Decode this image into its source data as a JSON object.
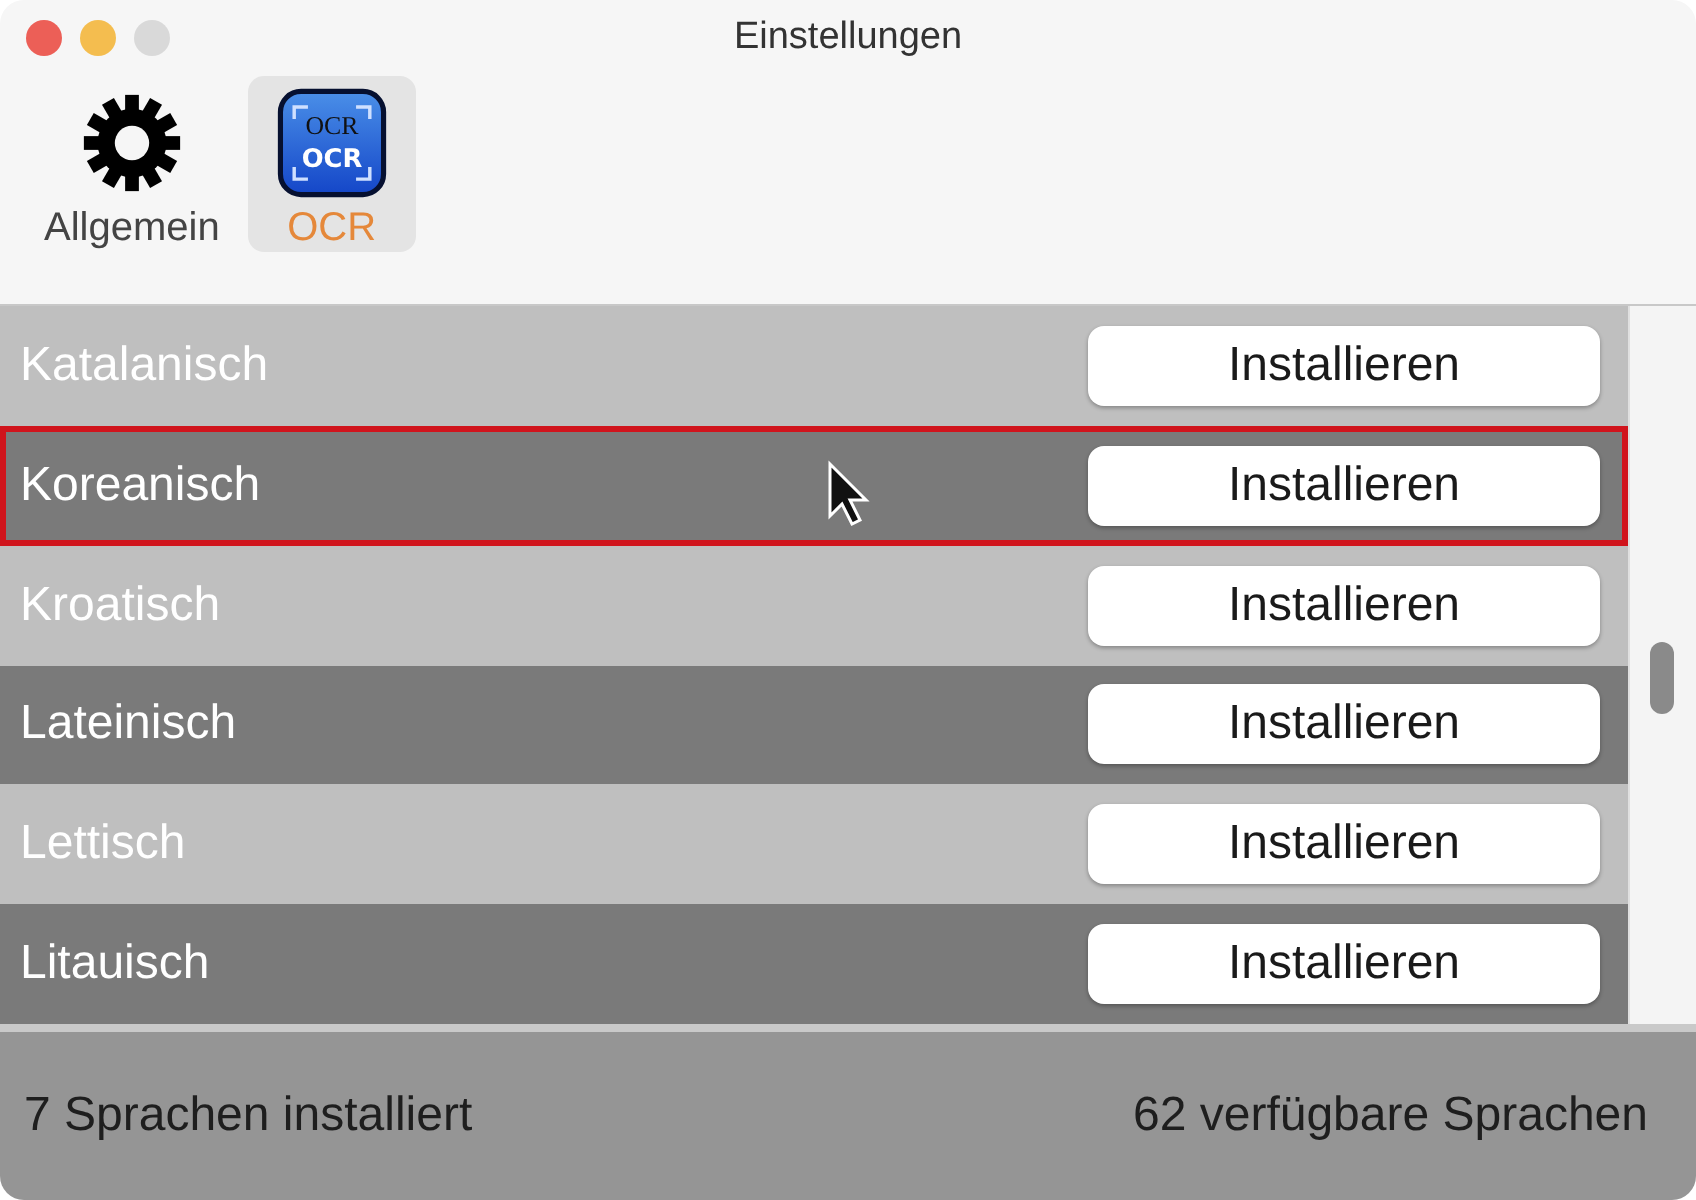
{
  "window": {
    "title": "Einstellungen"
  },
  "tabs": [
    {
      "label": "Allgemein",
      "kind": "gear",
      "selected": false
    },
    {
      "label": "OCR",
      "kind": "ocr",
      "icon_text": [
        "OCR",
        "OCR"
      ],
      "selected": true
    }
  ],
  "languages": [
    {
      "name": "Katalanisch",
      "button": "Installieren",
      "selected": false
    },
    {
      "name": "Koreanisch",
      "button": "Installieren",
      "selected": true
    },
    {
      "name": "Kroatisch",
      "button": "Installieren",
      "selected": false
    },
    {
      "name": "Lateinisch",
      "button": "Installieren",
      "selected": false
    },
    {
      "name": "Lettisch",
      "button": "Installieren",
      "selected": false
    },
    {
      "name": "Litauisch",
      "button": "Installieren",
      "selected": false
    }
  ],
  "status_bar": {
    "installed": "7 Sprachen installiert",
    "available": "62 verfügbare Sprachen"
  }
}
